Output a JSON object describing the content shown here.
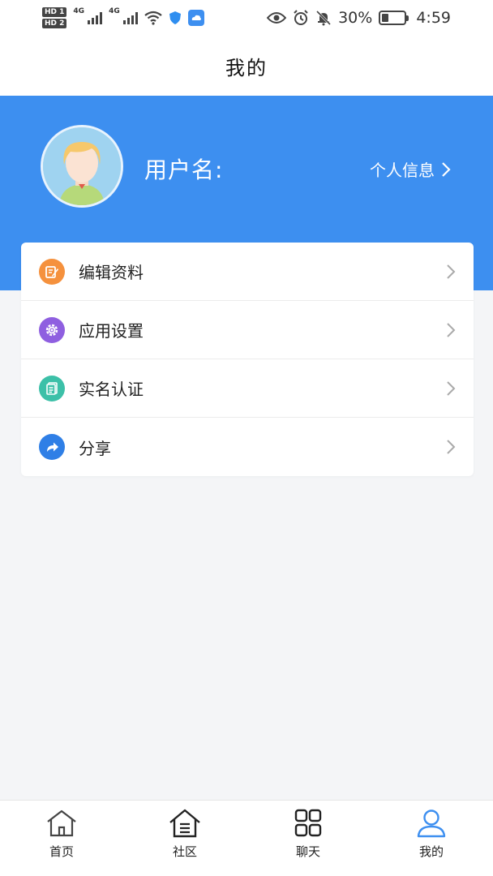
{
  "status_bar": {
    "hd1": "HD 1",
    "hd2": "HD 2",
    "net1": "4G",
    "net2": "4G",
    "battery": "30%",
    "battery_level": 0.3,
    "time": "4:59"
  },
  "header": {
    "title": "我的"
  },
  "profile": {
    "username_label": "用户名:",
    "info_link": "个人信息"
  },
  "menu": {
    "items": [
      {
        "label": "编辑资料",
        "icon": "edit-icon",
        "color": "#f5913d"
      },
      {
        "label": "应用设置",
        "icon": "settings-icon",
        "color": "#8f5fe0"
      },
      {
        "label": "实名认证",
        "icon": "id-card-icon",
        "color": "#3cc0a8"
      },
      {
        "label": "分享",
        "icon": "share-icon",
        "color": "#2f7fe6"
      }
    ]
  },
  "tabs": [
    {
      "label": "首页",
      "icon": "home-icon"
    },
    {
      "label": "社区",
      "icon": "community-icon"
    },
    {
      "label": "聊天",
      "icon": "grid-icon"
    },
    {
      "label": "我的",
      "icon": "user-icon",
      "active": true
    }
  ],
  "colors": {
    "primary": "#3d8ff0",
    "background": "#f4f5f7",
    "active_tab": "#3d8ff0"
  }
}
